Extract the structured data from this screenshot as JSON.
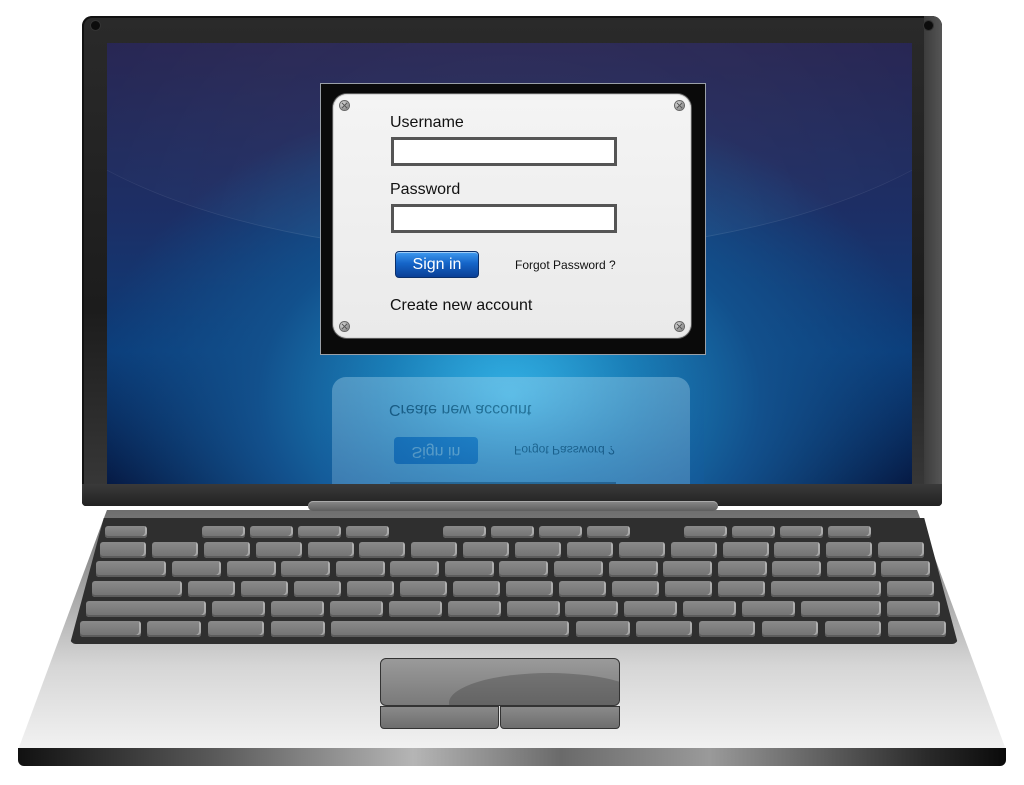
{
  "login": {
    "username_label": "Username",
    "username_value": "",
    "password_label": "Password",
    "password_value": "",
    "signin_label": "Sign in",
    "forgot_label": "Forgot Password ?",
    "create_label": "Create new account"
  },
  "colors": {
    "signin_button": "#1565c8",
    "screen_glow": "#35b7ea",
    "screen_top": "#282653"
  },
  "icons": {
    "panel_screws": "screw-icon",
    "webcam": "webcam-icon"
  }
}
